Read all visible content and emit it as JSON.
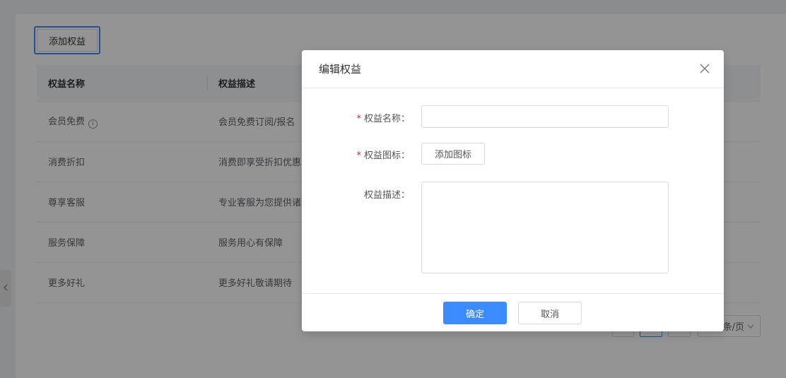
{
  "toolbar": {
    "add_label": "添加权益"
  },
  "table": {
    "headers": [
      "权益名称",
      "权益描述"
    ],
    "rows": [
      {
        "name": "会员免费",
        "desc": "会员免费订阅/报名"
      },
      {
        "name": "消费折扣",
        "desc": "消费即享受折扣优惠"
      },
      {
        "name": "尊享客服",
        "desc": "专业客服为您提供诸"
      },
      {
        "name": "服务保障",
        "desc": "服务用心有保障"
      },
      {
        "name": "更多好礼",
        "desc": "更多好礼敬请期待"
      }
    ]
  },
  "pagination": {
    "page_size_label": "条/页"
  },
  "dialog": {
    "title": "编辑权益",
    "name_label": "权益名称：",
    "icon_label": "权益图标：",
    "desc_label": "权益描述：",
    "name_value": "",
    "desc_value": "",
    "add_icon_label": "添加图标",
    "required_mark": "*",
    "ok_label": "确定",
    "cancel_label": "取消"
  },
  "colors": {
    "primary": "#3d8cff",
    "required": "#e02020"
  },
  "icons": {
    "close": "close-icon",
    "info": "info-icon",
    "expand": "chevron-left-icon"
  }
}
